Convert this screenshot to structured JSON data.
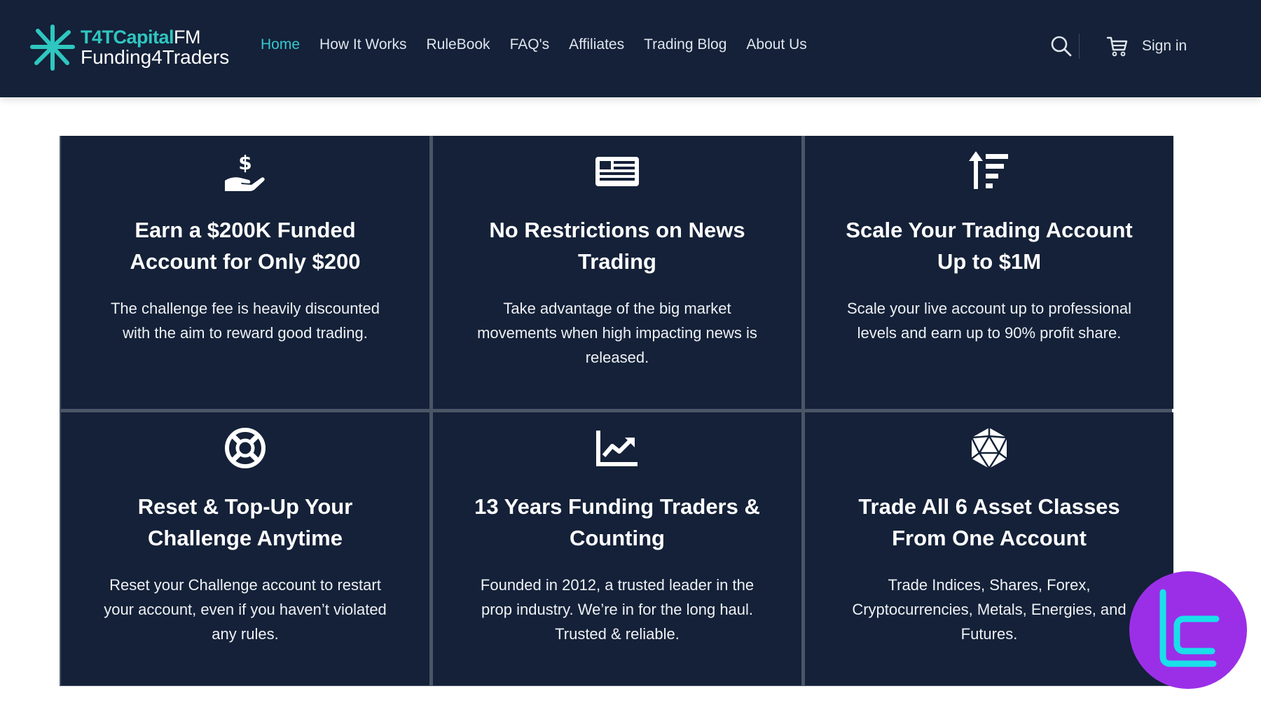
{
  "header": {
    "brand": {
      "line1_main": "T4TCapital",
      "line1_suffix": "FM",
      "line2": "Funding4Traders"
    },
    "nav": [
      {
        "label": "Home",
        "active": true
      },
      {
        "label": "How It Works"
      },
      {
        "label": "RuleBook"
      },
      {
        "label": "FAQ's"
      },
      {
        "label": "Affiliates"
      },
      {
        "label": "Trading Blog"
      },
      {
        "label": "About Us"
      }
    ],
    "search_icon": "search-icon",
    "cart_icon": "cart-icon",
    "signin_label": "Sign in"
  },
  "features": [
    {
      "icon": "hand-dollar-icon",
      "title": "Earn a $200K Funded Account for Only $200",
      "desc": "The challenge fee is heavily discounted with the aim to reward good trading."
    },
    {
      "icon": "newspaper-icon",
      "title": "No Restrictions on News Trading",
      "desc": "Take advantage of the big market movements when high impacting news is released."
    },
    {
      "icon": "sort-amount-up-icon",
      "title": "Scale Your Trading Account Up to $1M",
      "desc": "Scale your live account up to professional levels and earn up to 90% profit share."
    },
    {
      "icon": "life-ring-icon",
      "title": "Reset & Top-Up Your Challenge Anytime",
      "desc": "Reset your Challenge account to restart your account, even if you haven’t violated any rules."
    },
    {
      "icon": "chart-line-icon",
      "title": "13 Years Funding Traders & Counting",
      "desc": "Founded in 2012, a trusted leader in the prop industry. We’re in for the long haul. Trusted & reliable."
    },
    {
      "icon": "dice-d20-icon",
      "title": "Trade All 6 Asset Classes From One Account",
      "desc": "Trade Indices, Shares, Forex, Cryptocurrencies, Metals, Energies, and Futures."
    }
  ],
  "colors": {
    "navy": "#142138",
    "teal": "#2fc6c0",
    "badge_purple": "#9b2fe8",
    "badge_cyan": "#19e0ea"
  }
}
